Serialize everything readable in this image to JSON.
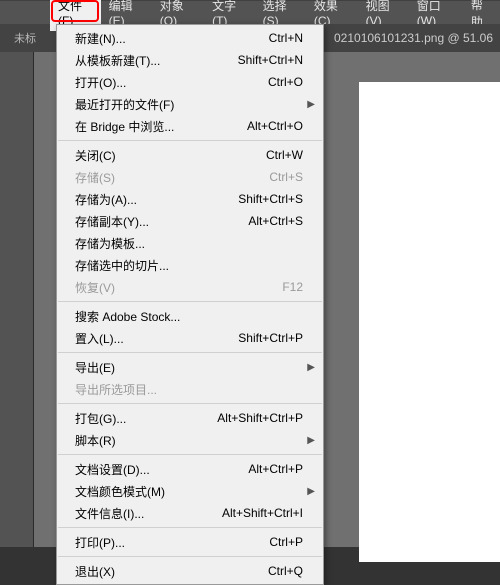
{
  "menubar": {
    "items": [
      {
        "label": "文件(F)"
      },
      {
        "label": "编辑(E)"
      },
      {
        "label": "对象(O)"
      },
      {
        "label": "文字(T)"
      },
      {
        "label": "选择(S)"
      },
      {
        "label": "效果(C)"
      },
      {
        "label": "视图(V)"
      },
      {
        "label": "窗口(W)"
      },
      {
        "label": "帮助"
      }
    ]
  },
  "toolbar": {
    "left_text": "未标"
  },
  "document_tab": {
    "label": "0210106101231.png @ 51.06"
  },
  "menu": {
    "groups": [
      [
        {
          "label": "新建(N)...",
          "shortcut": "Ctrl+N"
        },
        {
          "label": "从模板新建(T)...",
          "shortcut": "Shift+Ctrl+N"
        },
        {
          "label": "打开(O)...",
          "shortcut": "Ctrl+O"
        },
        {
          "label": "最近打开的文件(F)",
          "submenu": true
        },
        {
          "label": "在 Bridge 中浏览...",
          "shortcut": "Alt+Ctrl+O"
        }
      ],
      [
        {
          "label": "关闭(C)",
          "shortcut": "Ctrl+W"
        },
        {
          "label": "存储(S)",
          "shortcut": "Ctrl+S",
          "disabled": true
        },
        {
          "label": "存储为(A)...",
          "shortcut": "Shift+Ctrl+S"
        },
        {
          "label": "存储副本(Y)...",
          "shortcut": "Alt+Ctrl+S"
        },
        {
          "label": "存储为模板..."
        },
        {
          "label": "存储选中的切片..."
        },
        {
          "label": "恢复(V)",
          "shortcut": "F12",
          "disabled": true
        }
      ],
      [
        {
          "label": "搜索 Adobe Stock..."
        },
        {
          "label": "置入(L)...",
          "shortcut": "Shift+Ctrl+P"
        }
      ],
      [
        {
          "label": "导出(E)",
          "submenu": true
        },
        {
          "label": "导出所选项目...",
          "disabled": true
        }
      ],
      [
        {
          "label": "打包(G)...",
          "shortcut": "Alt+Shift+Ctrl+P"
        },
        {
          "label": "脚本(R)",
          "submenu": true
        }
      ],
      [
        {
          "label": "文档设置(D)...",
          "shortcut": "Alt+Ctrl+P"
        },
        {
          "label": "文档颜色模式(M)",
          "submenu": true
        },
        {
          "label": "文件信息(I)...",
          "shortcut": "Alt+Shift+Ctrl+I"
        }
      ],
      [
        {
          "label": "打印(P)...",
          "shortcut": "Ctrl+P"
        }
      ],
      [
        {
          "label": "退出(X)",
          "shortcut": "Ctrl+Q"
        }
      ]
    ]
  }
}
